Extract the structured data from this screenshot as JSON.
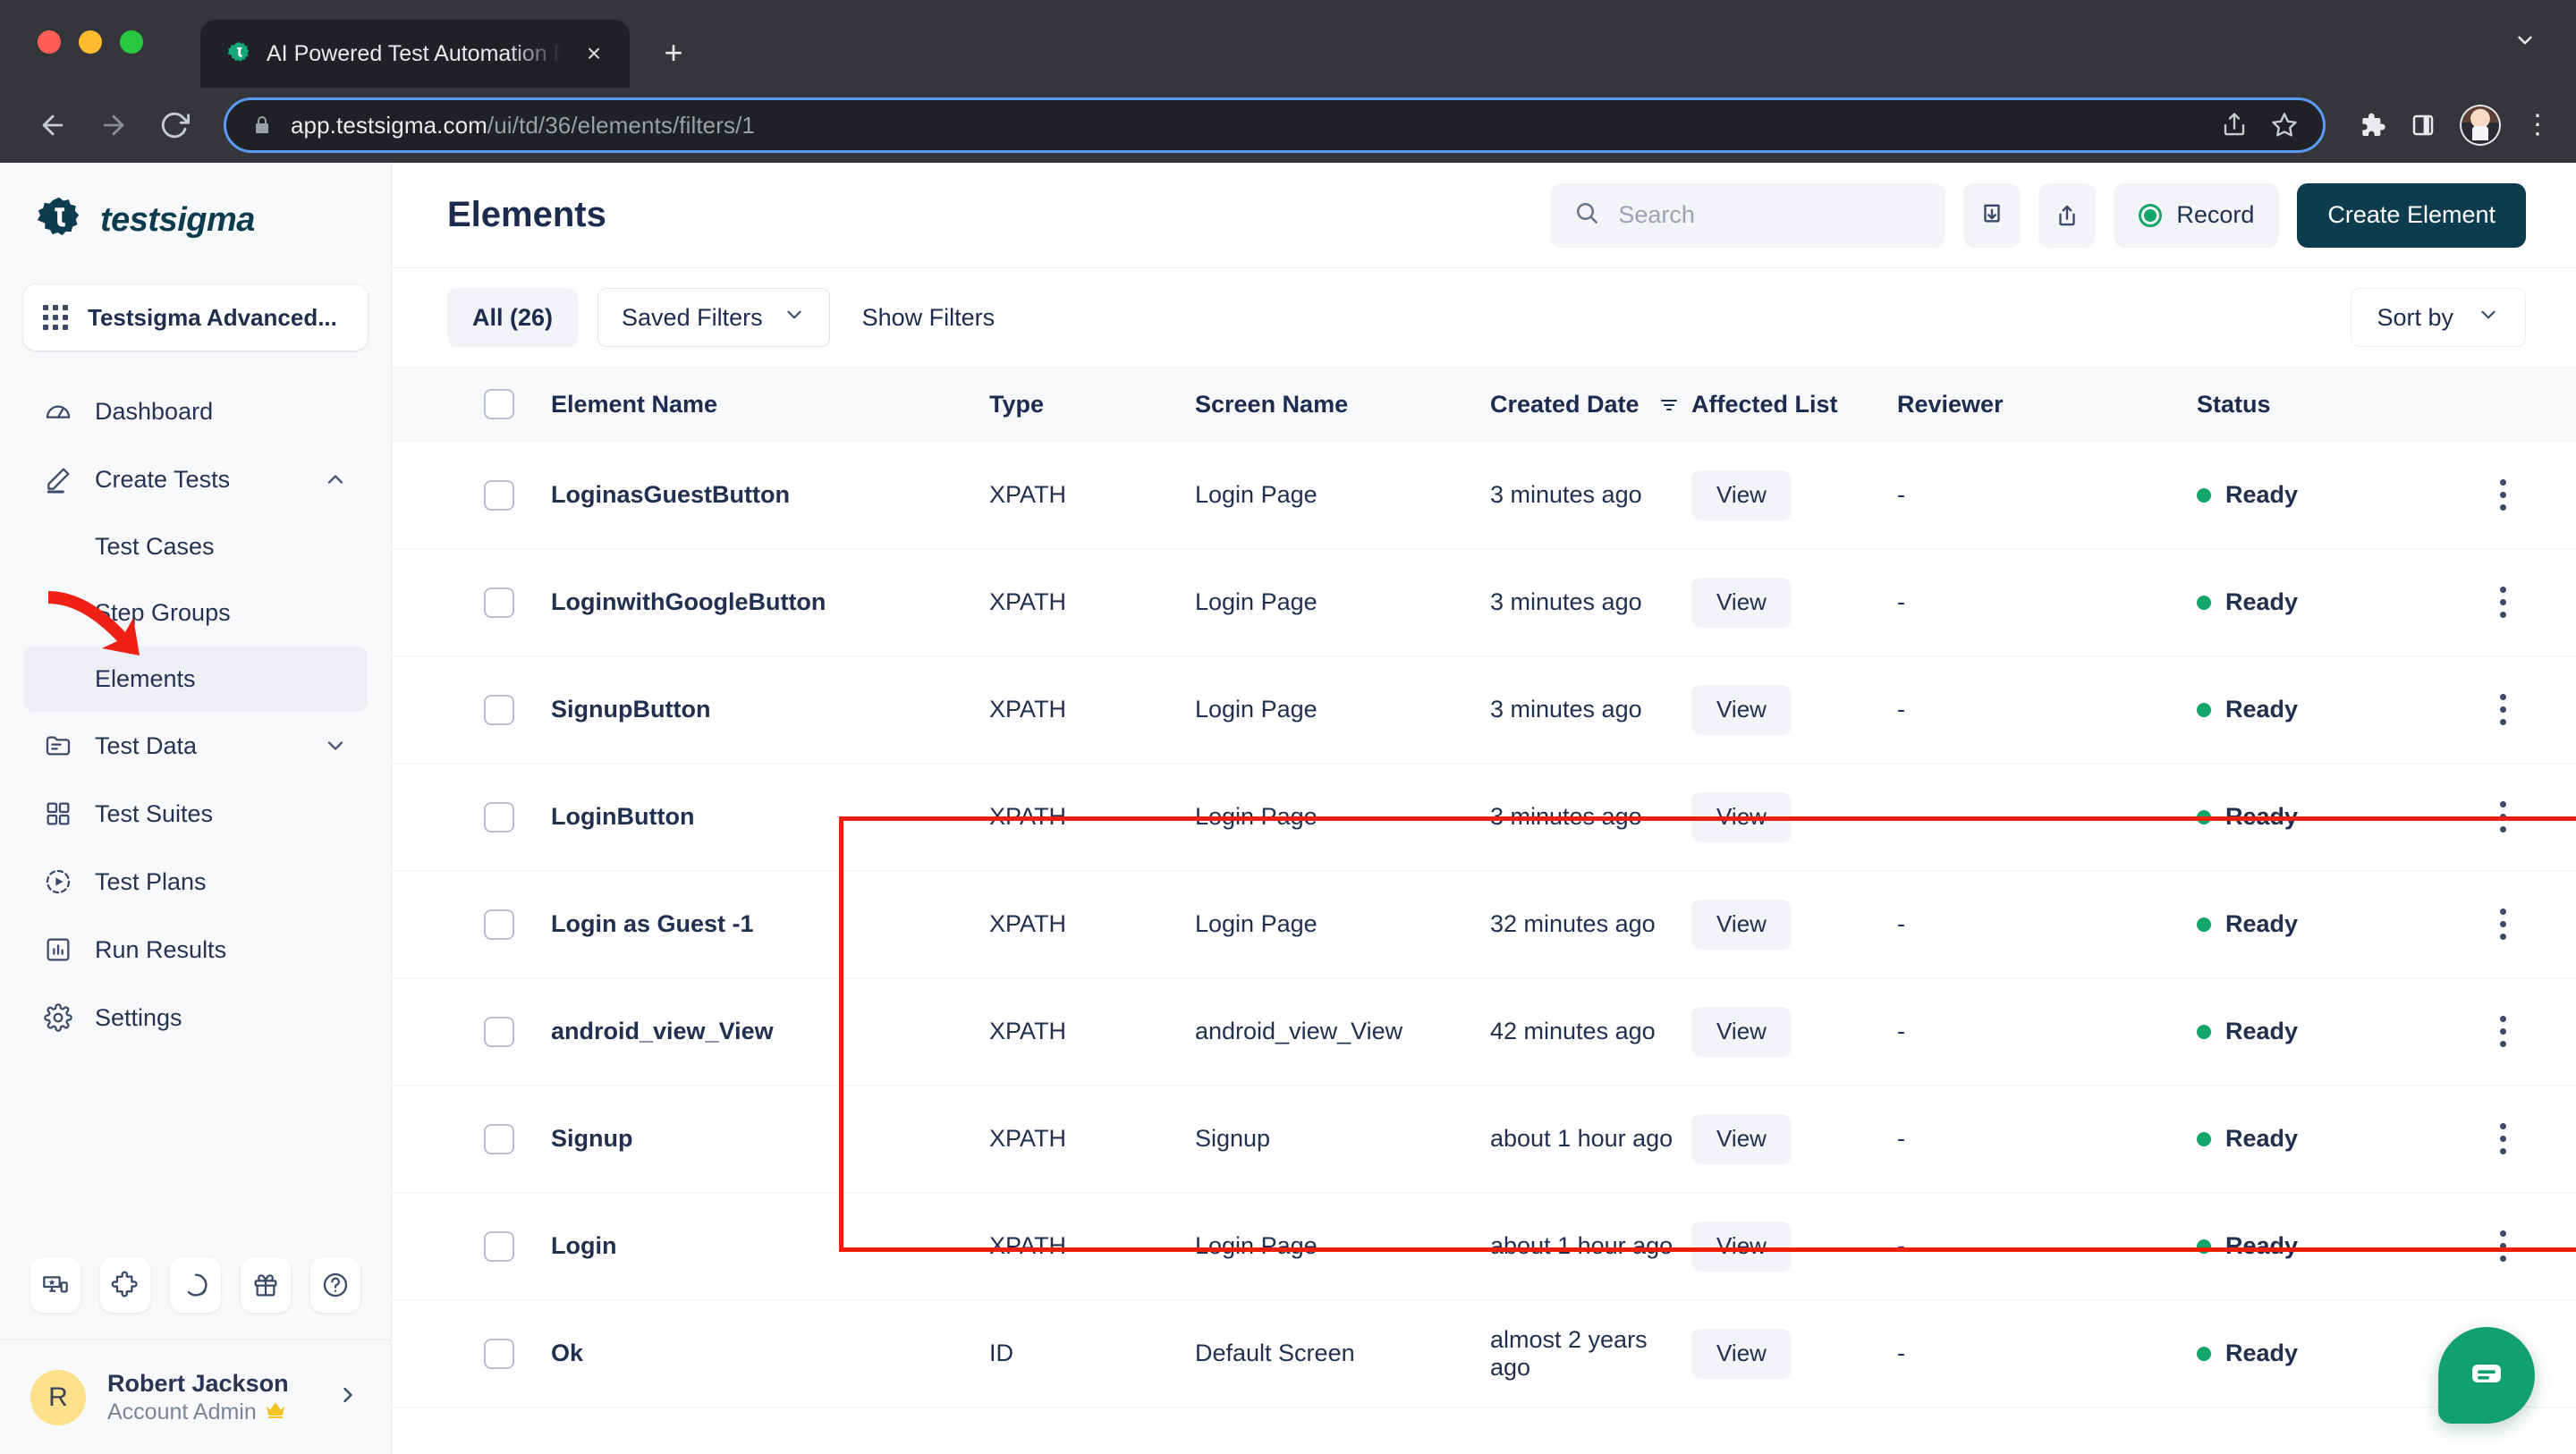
{
  "browser": {
    "tab_title": "AI Powered Test Automation Pl",
    "favicon": "testsigma-gear-icon",
    "new_tab_label": "+",
    "close_label": "×",
    "url_host": "app.testsigma.com",
    "url_path": "/ui/td/36/elements/filters/1",
    "collapse_label": "⌄"
  },
  "sidebar": {
    "brand": "testsigma",
    "project": "Testsigma Advanced...",
    "items": [
      {
        "label": "Dashboard",
        "icon": "gauge-icon",
        "type": "item",
        "active": false
      },
      {
        "label": "Create Tests",
        "icon": "pencil-icon",
        "type": "item",
        "active": false,
        "expanded": true
      },
      {
        "label": "Test Cases",
        "icon": "",
        "type": "sub",
        "active": false
      },
      {
        "label": "Step Groups",
        "icon": "",
        "type": "sub",
        "active": false
      },
      {
        "label": "Elements",
        "icon": "",
        "type": "sub",
        "active": true
      },
      {
        "label": "Test Data",
        "icon": "folder-icon",
        "type": "item",
        "active": false,
        "collapsed": true
      },
      {
        "label": "Test Suites",
        "icon": "grid-squares-icon",
        "type": "item",
        "active": false
      },
      {
        "label": "Test Plans",
        "icon": "play-circle-icon",
        "type": "item",
        "active": false
      },
      {
        "label": "Run Results",
        "icon": "bar-chart-icon",
        "type": "item",
        "active": false
      },
      {
        "label": "Settings",
        "icon": "gear-icon",
        "type": "item",
        "active": false
      }
    ],
    "quick_icons": [
      "devices-star-icon",
      "puzzle-icon",
      "progress-circle-icon",
      "gift-icon",
      "help-circle-icon"
    ],
    "user": {
      "initial": "R",
      "name": "Robert Jackson",
      "role": "Account Admin",
      "role_badge": "crown-icon"
    }
  },
  "header": {
    "title": "Elements",
    "search_placeholder": "Search",
    "search_value": "",
    "import_icon": "import-icon",
    "export_icon": "export-icon",
    "record_label": "Record",
    "create_label": "Create Element"
  },
  "filters": {
    "all_label": "All (26)",
    "saved_filters_label": "Saved Filters",
    "show_filters_label": "Show Filters",
    "sort_by_label": "Sort by"
  },
  "table": {
    "columns": [
      "Element Name",
      "Type",
      "Screen Name",
      "Created Date",
      "Affected List",
      "Reviewer",
      "Status"
    ],
    "sorted_column": "Created Date",
    "rows": [
      {
        "name": "LoginasGuestButton",
        "type": "XPATH",
        "screen": "Login Page",
        "created": "3 minutes ago",
        "affected": "View",
        "reviewer": "-",
        "status": "Ready",
        "highlighted": true
      },
      {
        "name": "LoginwithGoogleButton",
        "type": "XPATH",
        "screen": "Login Page",
        "created": "3 minutes ago",
        "affected": "View",
        "reviewer": "-",
        "status": "Ready",
        "highlighted": true
      },
      {
        "name": "SignupButton",
        "type": "XPATH",
        "screen": "Login Page",
        "created": "3 minutes ago",
        "affected": "View",
        "reviewer": "-",
        "status": "Ready",
        "highlighted": true
      },
      {
        "name": "LoginButton",
        "type": "XPATH",
        "screen": "Login Page",
        "created": "3 minutes ago",
        "affected": "View",
        "reviewer": "-",
        "status": "Ready",
        "highlighted": true
      },
      {
        "name": "Login as Guest -1",
        "type": "XPATH",
        "screen": "Login Page",
        "created": "32 minutes ago",
        "affected": "View",
        "reviewer": "-",
        "status": "Ready",
        "highlighted": false
      },
      {
        "name": "android_view_View",
        "type": "XPATH",
        "screen": "android_view_View",
        "created": "42 minutes ago",
        "affected": "View",
        "reviewer": "-",
        "status": "Ready",
        "highlighted": false
      },
      {
        "name": "Signup",
        "type": "XPATH",
        "screen": "Signup",
        "created": "about 1 hour ago",
        "affected": "View",
        "reviewer": "-",
        "status": "Ready",
        "highlighted": false
      },
      {
        "name": "Login",
        "type": "XPATH",
        "screen": "Login Page",
        "created": "about 1 hour ago",
        "affected": "View",
        "reviewer": "-",
        "status": "Ready",
        "highlighted": false
      },
      {
        "name": "Ok",
        "type": "ID",
        "screen": "Default Screen",
        "created": "almost 2 years ago",
        "affected": "View",
        "reviewer": "-",
        "status": "Ready",
        "highlighted": false
      }
    ]
  },
  "annotations": {
    "highlight_box_color": "#f01f08",
    "arrow_color": "#ef2015",
    "arrow_target": "Elements"
  },
  "chat": {
    "icon": "chat-bubble-icon",
    "color": "#12a071"
  },
  "colors": {
    "brand": "#0d3c4f",
    "accent_green": "#10a56a",
    "text": "#1d2b4f",
    "sidebar_bg": "#f8f9fb"
  }
}
